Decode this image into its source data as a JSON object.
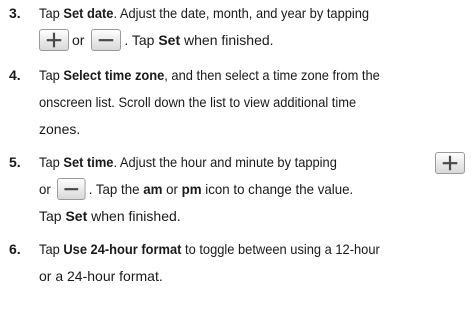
{
  "steps": [
    {
      "number": "3.",
      "t1": "Tap ",
      "b1": "Set date",
      "t2": ". Adjust the date, month, and year by tapping",
      "t3": "or",
      "t4": ". Tap ",
      "b2": "Set",
      "t5": " when finished."
    },
    {
      "number": "4.",
      "t1": "Tap ",
      "b1": "Select time zone",
      "t2": ", and then select a time zone from the",
      "t3": "onscreen list. Scroll down the list to view additional time",
      "t4": "zones."
    },
    {
      "number": "5.",
      "t1": "Tap ",
      "b1": "Set time",
      "t2": ". Adjust the hour and minute by tapping",
      "t3": "or",
      "t4": ". Tap the ",
      "b2": "am",
      "t5": " or ",
      "b3": "pm",
      "t6": " icon to change the value.",
      "t7": "Tap ",
      "b4": "Set",
      "t8": " when finished."
    },
    {
      "number": "6.",
      "t1": "Tap ",
      "b1": "Use 24-hour format",
      "t2": " to toggle between using a 12-hour",
      "t3": "or a 24-hour format."
    }
  ],
  "icons": {
    "plus": "plus-icon",
    "minus": "minus-icon",
    "icon_color": "#4a4a4a"
  }
}
